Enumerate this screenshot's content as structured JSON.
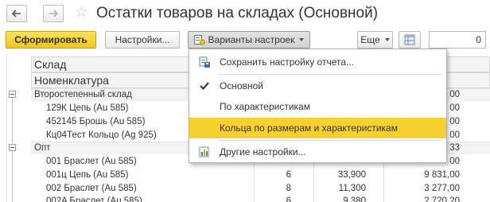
{
  "window": {
    "title": "Остатки товаров на складах (Основной)"
  },
  "toolbar": {
    "generate_label": "Сформировать",
    "settings_label": "Настройки...",
    "variants_label": "Варианты настроек",
    "more_label": "Еще",
    "number_value": "0"
  },
  "table": {
    "header_col1": "Склад",
    "header_col2": "Номенклатура",
    "rows": [
      {
        "name": "Второстепенный склад",
        "c1": "",
        "c2": "",
        "c3": "00"
      },
      {
        "name": "129К Цепь (Au 585)",
        "c1": "",
        "c2": "",
        "c3": "00"
      },
      {
        "name": "452145 Брошь (Au 585)",
        "c1": "",
        "c2": "",
        "c3": "00"
      },
      {
        "name": "Кц04Тест Кольцо (Ag 925)",
        "c1": "",
        "c2": "",
        "c3": "00"
      },
      {
        "name": "Опт",
        "c1": "",
        "c2": "",
        "c3": "33"
      },
      {
        "name": "001 Браслет (Au 585)",
        "c1": "",
        "c2": "",
        "c3": "00"
      },
      {
        "name": "001ц Цепь (Au 585)",
        "c1": "6",
        "c2": "33,900",
        "c3": "9 831,00"
      },
      {
        "name": "002 Браслет (Au 585)",
        "c1": "8",
        "c2": "11,300",
        "c3": "3 277,00"
      },
      {
        "name": "002A Браслет (Au 585)",
        "c1": "6",
        "c2": "9,380",
        "c3": "2 720,20"
      }
    ]
  },
  "variants_menu": {
    "items": [
      {
        "label": "Сохранить настройку отчета..."
      },
      {
        "label": "Основной"
      },
      {
        "label": "По характеристикам"
      },
      {
        "label": "Кольца по размерам и характеристикам"
      },
      {
        "label": "Другие настройки..."
      }
    ]
  },
  "colors": {
    "accent_yellow": "#f8d131",
    "primary_button": "#f2c51f"
  }
}
